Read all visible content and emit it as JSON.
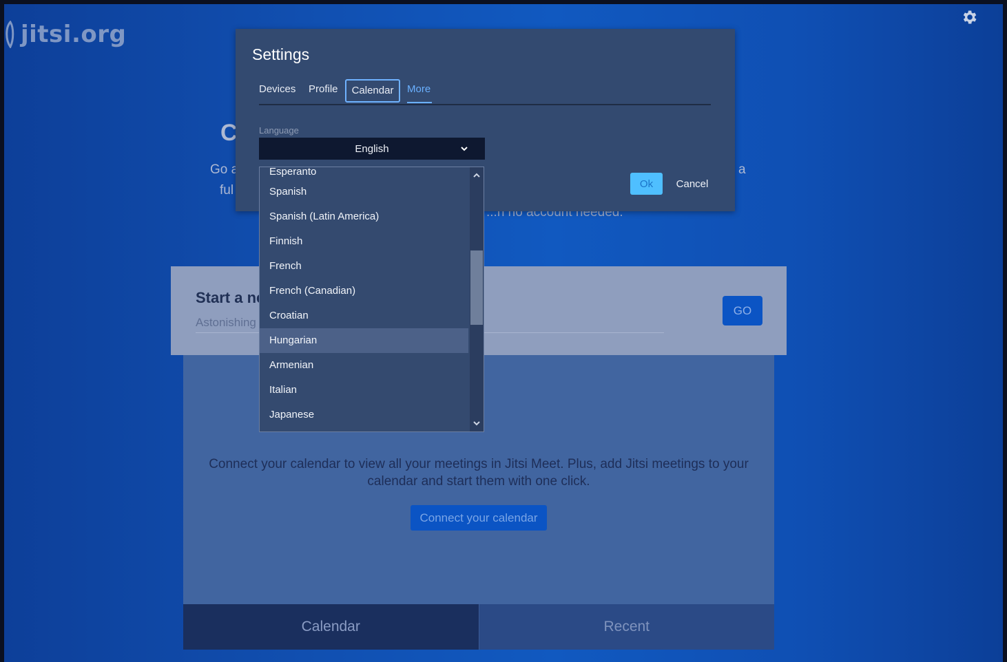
{
  "brand": {
    "logo_text": "jitsi.org"
  },
  "header": {
    "settings_icon": "gear-icon"
  },
  "hero": {
    "title_fragment": "C",
    "line1_fragment": "Go a",
    "line2_fragment": "ful",
    "line1_tail_fragment": "a",
    "line3_tail_fragment": "...n no account needed."
  },
  "welcome": {
    "title_fragment": "Start a ne",
    "room_placeholder": "Astonishing",
    "go_label": "GO"
  },
  "calendar_panel": {
    "description": "Connect your calendar to view all your meetings in Jitsi Meet. Plus, add Jitsi meetings to your calendar and start them with one click.",
    "connect_label": "Connect your calendar"
  },
  "bottom_tabs": {
    "calendar": "Calendar",
    "recent": "Recent"
  },
  "settings": {
    "title": "Settings",
    "tabs": {
      "devices": "Devices",
      "profile": "Profile",
      "calendar": "Calendar",
      "more": "More"
    },
    "language_label": "Language",
    "language_value": "English",
    "ok_label": "Ok",
    "cancel_label": "Cancel",
    "languages": [
      "Esperanto",
      "Spanish",
      "Spanish (Latin America)",
      "Finnish",
      "French",
      "French (Canadian)",
      "Croatian",
      "Hungarian",
      "Armenian",
      "Italian",
      "Japanese"
    ],
    "hovered_language": "Hungarian"
  },
  "colors": {
    "accent": "#4fbfff",
    "primary_button": "#0b54c4",
    "dialog_bg": "#334a70"
  }
}
